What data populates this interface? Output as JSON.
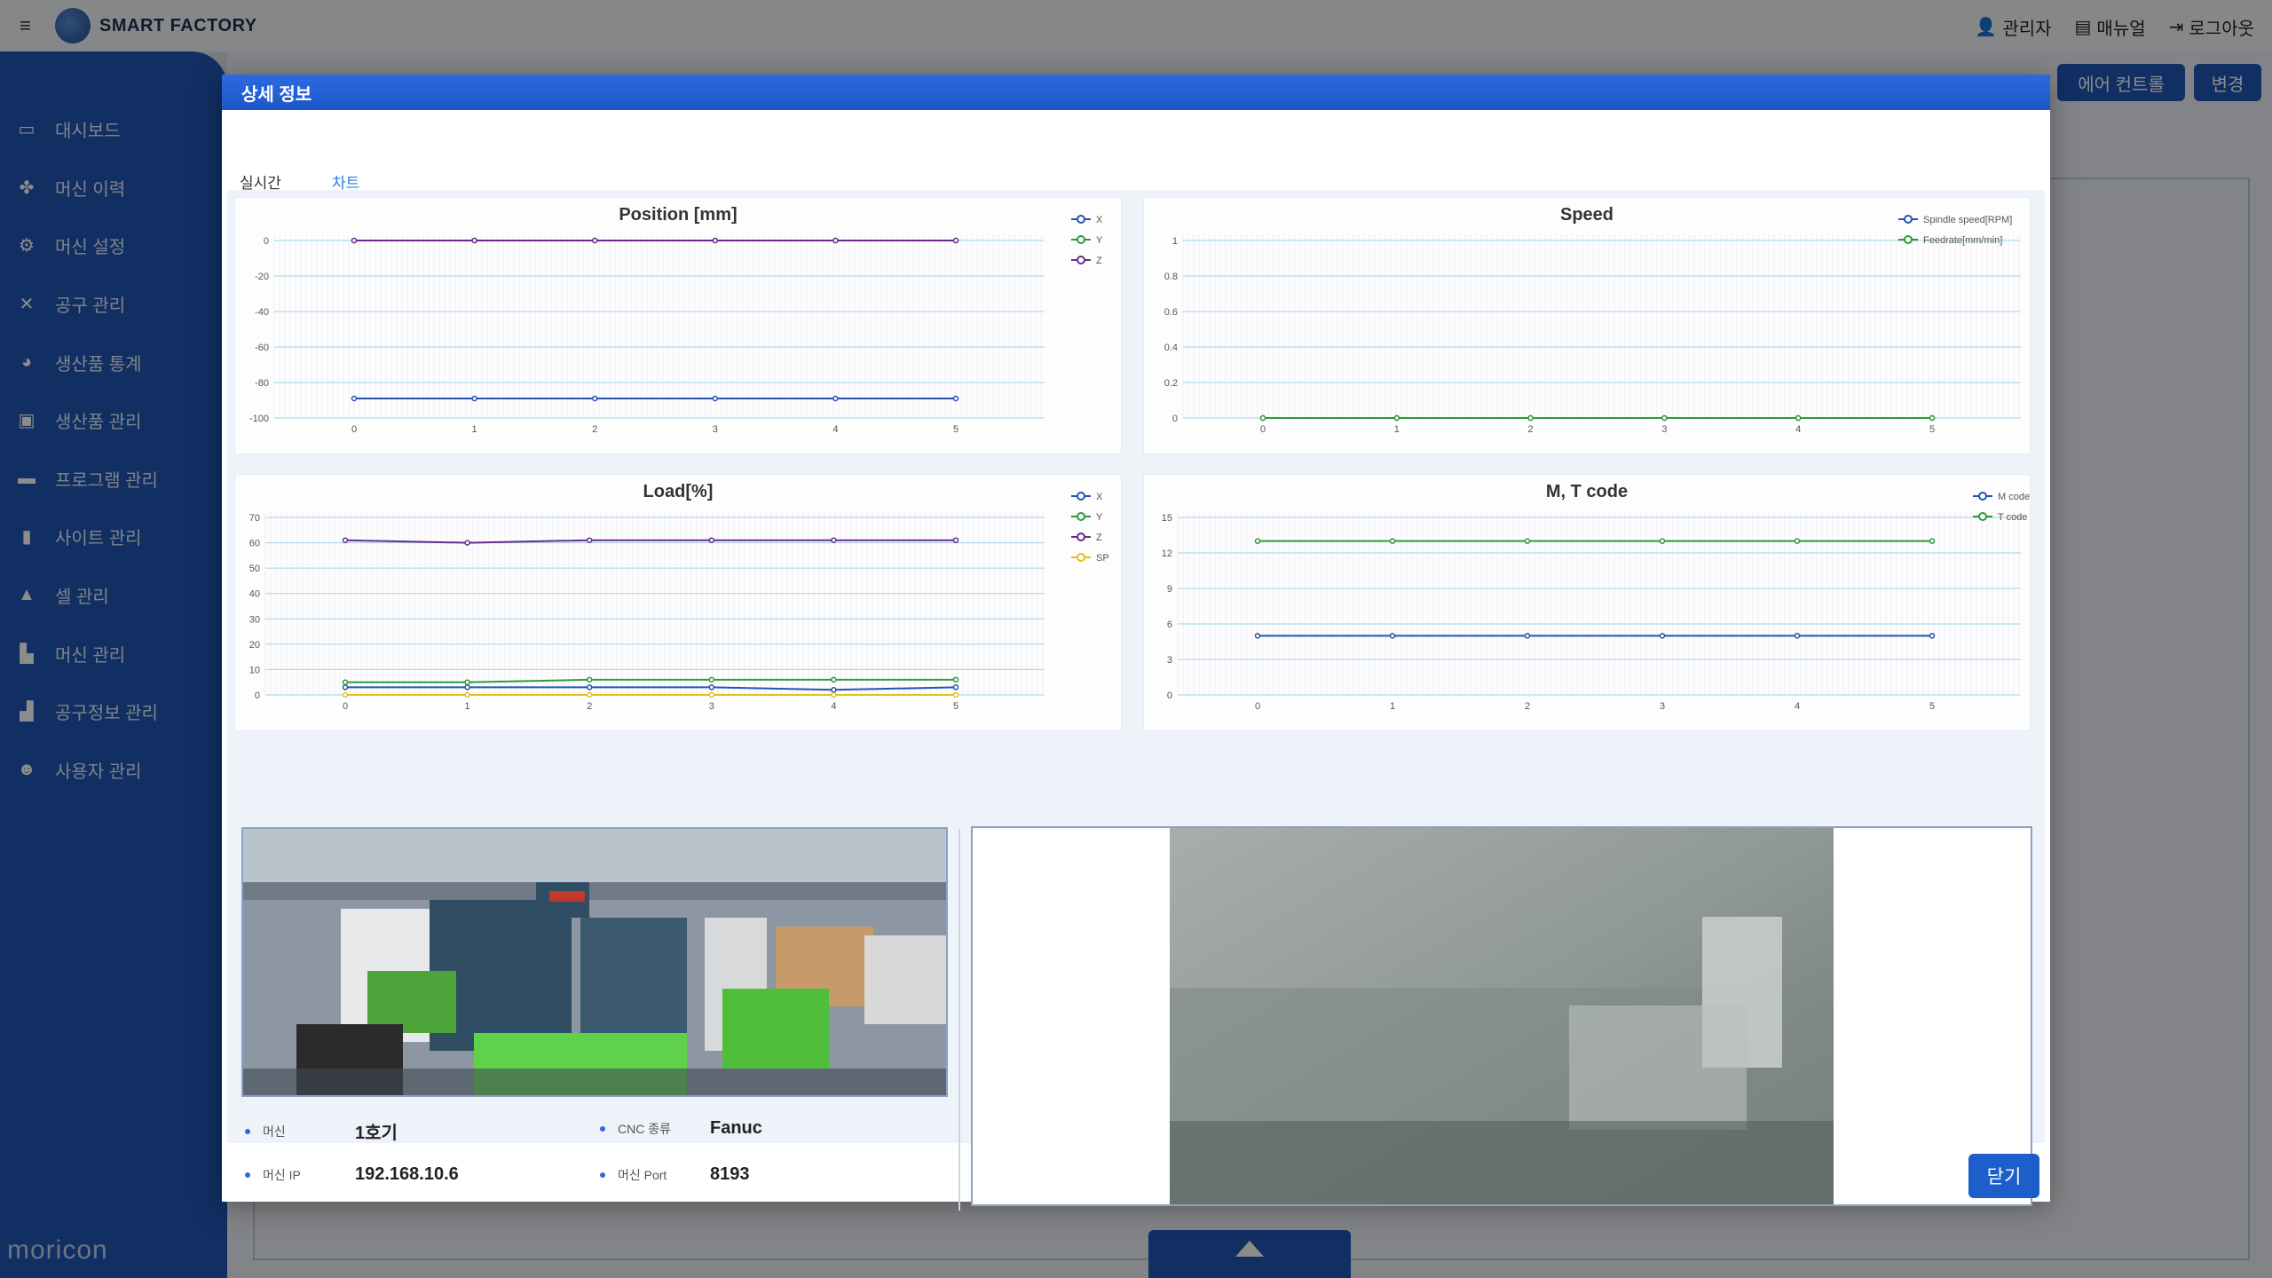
{
  "app": {
    "brand": "SMART FACTORY",
    "top_links": [
      {
        "icon": "user-icon",
        "label": "관리자"
      },
      {
        "icon": "manual-icon",
        "label": "매뉴얼"
      },
      {
        "icon": "logout-icon",
        "label": "로그아웃"
      }
    ],
    "sidebar": [
      {
        "icon": "monitor-icon",
        "label": "대시보드"
      },
      {
        "icon": "history-icon",
        "label": "머신 이력"
      },
      {
        "icon": "settings-icon",
        "label": "머신 설정"
      },
      {
        "icon": "tools-icon",
        "label": "공구 관리"
      },
      {
        "icon": "stats-icon",
        "label": "생산품 통계"
      },
      {
        "icon": "product-icon",
        "label": "생산품 관리"
      },
      {
        "icon": "program-icon",
        "label": "프로그램 관리"
      },
      {
        "icon": "site-icon",
        "label": "사이트 관리"
      },
      {
        "icon": "cell-icon",
        "label": "셀 관리"
      },
      {
        "icon": "machine-icon",
        "label": "머신 관리"
      },
      {
        "icon": "tool-info-icon",
        "label": "공구정보 관리"
      },
      {
        "icon": "users-icon",
        "label": "사용자 관리"
      }
    ],
    "side_logo": "moricon",
    "bg_buttons": [
      "에어 컨트롤",
      "변경"
    ]
  },
  "modal": {
    "title": "상세 정보",
    "tabs": [
      {
        "label": "실시간",
        "active": false
      },
      {
        "label": "차트",
        "active": true
      }
    ],
    "close_label": "닫기",
    "machine_info": [
      {
        "label": "머신",
        "value": "1호기"
      },
      {
        "label": "CNC 종류",
        "value": "Fanuc"
      },
      {
        "label": "머신 IP",
        "value": "192.168.10.6"
      },
      {
        "label": "머신 Port",
        "value": "8193"
      }
    ]
  },
  "colors": {
    "accent": "#1f56b5",
    "X": "#2452b0",
    "Y": "#2c9a3a",
    "Z": "#6b2a8c",
    "SP": "#e2c21a"
  },
  "chart_data": [
    {
      "type": "line",
      "title": "Position [mm]",
      "x": [
        0,
        1,
        2,
        3,
        4,
        5
      ],
      "ylim": [
        -100,
        0
      ],
      "yticks": [
        0,
        -20,
        -40,
        -60,
        -80,
        -100
      ],
      "series": [
        {
          "name": "X",
          "values": [
            -89,
            -89,
            -89,
            -89,
            -89,
            -89
          ]
        },
        {
          "name": "Y",
          "values": [
            0,
            0,
            0,
            0,
            0,
            0
          ]
        },
        {
          "name": "Z",
          "values": [
            0,
            0,
            0,
            0,
            0,
            0
          ]
        }
      ],
      "legend": "top-right"
    },
    {
      "type": "line",
      "title": "Speed",
      "x": [
        0,
        1,
        2,
        3,
        4,
        5
      ],
      "ylim": [
        0,
        1
      ],
      "yticks": [
        1,
        0.8,
        0.6,
        0.4,
        0.2,
        0
      ],
      "series": [
        {
          "name": "Spindle speed[RPM]",
          "values": [
            0,
            0,
            0,
            0,
            0,
            0
          ]
        },
        {
          "name": "Feedrate[mm/min]",
          "values": [
            0,
            0,
            0,
            0,
            0,
            0
          ]
        }
      ],
      "legend": "top-right"
    },
    {
      "type": "line",
      "title": "Load[%]",
      "x": [
        0,
        1,
        2,
        3,
        4,
        5
      ],
      "ylim": [
        0,
        70
      ],
      "yticks": [
        70,
        60,
        50,
        40,
        30,
        20,
        10,
        0
      ],
      "series": [
        {
          "name": "X",
          "values": [
            3,
            3,
            3,
            3,
            2,
            3
          ]
        },
        {
          "name": "Y",
          "values": [
            5,
            5,
            6,
            6,
            6,
            6
          ]
        },
        {
          "name": "Z",
          "values": [
            61,
            60,
            61,
            61,
            61,
            61
          ]
        },
        {
          "name": "SP",
          "values": [
            0,
            0,
            0,
            0,
            0,
            0
          ]
        }
      ],
      "legend": "top-right"
    },
    {
      "type": "line",
      "title": "M, T code",
      "x": [
        0,
        1,
        2,
        3,
        4,
        5
      ],
      "ylim": [
        0,
        15
      ],
      "yticks": [
        15,
        12,
        9,
        6,
        3,
        0
      ],
      "series": [
        {
          "name": "M code",
          "values": [
            5,
            5,
            5,
            5,
            5,
            5
          ]
        },
        {
          "name": "T code",
          "values": [
            13,
            13,
            13,
            13,
            13,
            13
          ]
        }
      ],
      "legend": "top-right"
    }
  ]
}
